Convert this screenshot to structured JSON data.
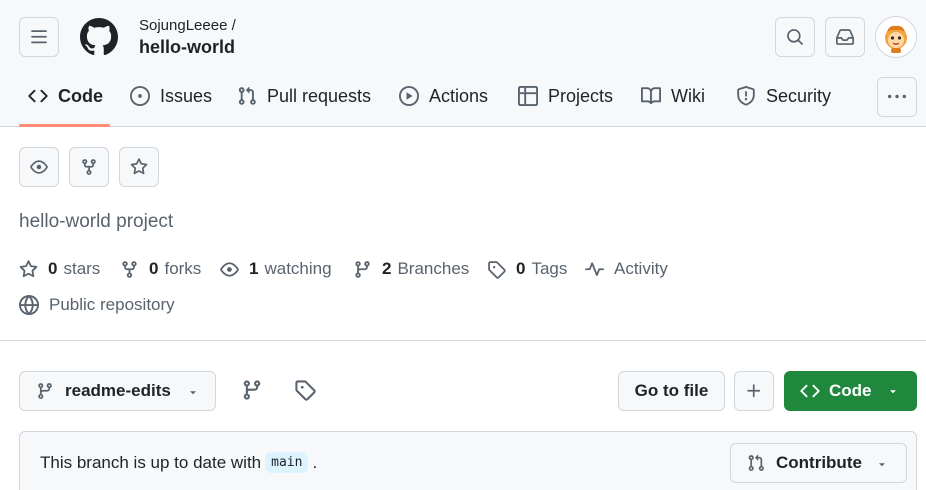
{
  "header": {
    "owner": "SojungLeeee /",
    "repo": "hello-world"
  },
  "tabs": [
    {
      "label": "Code",
      "icon": "code-icon",
      "active": true
    },
    {
      "label": "Issues",
      "icon": "issue-opened-icon"
    },
    {
      "label": "Pull requests",
      "icon": "git-pull-request-icon"
    },
    {
      "label": "Actions",
      "icon": "play-icon"
    },
    {
      "label": "Projects",
      "icon": "table-icon"
    },
    {
      "label": "Wiki",
      "icon": "book-icon"
    },
    {
      "label": "Security",
      "icon": "shield-icon"
    }
  ],
  "repo": {
    "description": "hello-world project",
    "stats": {
      "stars_count": "0",
      "stars_label": "stars",
      "forks_count": "0",
      "forks_label": "forks",
      "watching_count": "1",
      "watching_label": "watching",
      "branches_count": "2",
      "branches_label": "Branches",
      "tags_count": "0",
      "tags_label": "Tags",
      "activity_label": "Activity"
    },
    "visibility": "Public repository"
  },
  "toolbar": {
    "branch": "readme-edits",
    "goto_file": "Go to file",
    "code_label": "Code"
  },
  "branch_status": {
    "prefix": "This branch is up to date with",
    "base": "main",
    "suffix": ".",
    "contribute_label": "Contribute"
  },
  "colors": {
    "accent_underline": "#fd8c73",
    "primary_green": "#1f883d",
    "muted_text": "#59636e",
    "border": "#d0d7de",
    "subtle_bg": "#f6f8fa"
  }
}
